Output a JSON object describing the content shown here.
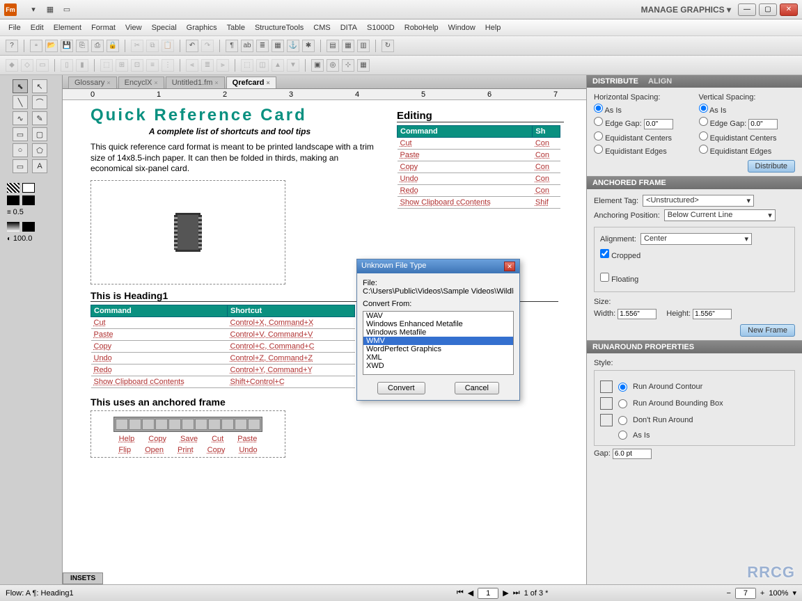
{
  "titlebar": {
    "manage": "MANAGE GRAPHICS ▾"
  },
  "menu": [
    "File",
    "Edit",
    "Element",
    "Format",
    "View",
    "Special",
    "Graphics",
    "Table",
    "StructureTools",
    "CMS",
    "DITA",
    "S1000D",
    "RoboHelp",
    "Window",
    "Help"
  ],
  "tabs": [
    {
      "label": "Glossary",
      "active": false
    },
    {
      "label": "EncyclX",
      "active": false
    },
    {
      "label": "Untitled1.fm",
      "active": false
    },
    {
      "label": "Qrefcard",
      "active": true
    }
  ],
  "ruler": [
    "0",
    "1",
    "2",
    "3",
    "4",
    "5",
    "6",
    "7"
  ],
  "doc": {
    "title": "Quick Reference Card",
    "subtitle": "A complete list of shortcuts and tool tips",
    "body": "This quick reference card format is meant to be printed landscape with a trim size of 14x8.5-inch paper. It can then be folded in thirds, making an economical six-panel card.",
    "heading1": "This is Heading1",
    "col_cmd": "Command",
    "col_sc": "Shortcut",
    "rows": [
      {
        "c": "Cut",
        "s": "Control+X, Command+X"
      },
      {
        "c": "Paste",
        "s": "Control+V, Command+V"
      },
      {
        "c": "Copy",
        "s": "Control+C, Command+C"
      },
      {
        "c": "Undo",
        "s": "Control+Z, Command+Z"
      },
      {
        "c": "Redo",
        "s": "Control+Y, Command+Y"
      },
      {
        "c": "Show Clipboard cContents",
        "s": "Shift+Control+C"
      }
    ],
    "heading2": "This uses an anchored frame",
    "icon_labels_top": [
      "Help",
      "Copy",
      "Save",
      "Cut",
      "Paste"
    ],
    "icon_labels_bot": [
      "Flip",
      "Open",
      "Print",
      "Copy",
      "Undo"
    ],
    "editing_title": "Editing",
    "edit_col_cmd": "Command",
    "edit_col_sc": "Sh",
    "edit_rows": [
      {
        "c": "Cut",
        "s": "Con"
      },
      {
        "c": "Paste",
        "s": "Con"
      },
      {
        "c": "Copy",
        "s": "Con"
      },
      {
        "c": "Undo",
        "s": "Con"
      },
      {
        "c": "Redo",
        "s": "Con"
      },
      {
        "c": "Show Clipboard cContents",
        "s": "Shif"
      }
    ]
  },
  "dialog": {
    "title": "Unknown File Type",
    "file_lbl": "File:",
    "file_path": "C:\\Users\\Public\\Videos\\Sample Videos\\Wildli",
    "convert_lbl": "Convert From:",
    "options": [
      "WAV",
      "Windows Enhanced Metafile",
      "Windows Metafile",
      "WMV",
      "WordPerfect Graphics",
      "XML",
      "XWD"
    ],
    "selected": "WMV",
    "convert_btn": "Convert",
    "cancel_btn": "Cancel"
  },
  "distribute": {
    "tab1": "DISTRIBUTE",
    "tab2": "ALIGN",
    "hspacing": "Horizontal Spacing:",
    "vspacing": "Vertical Spacing:",
    "asis": "As Is",
    "edgegap": "Edge Gap:",
    "eq_centers": "Equidistant Centers",
    "eq_edges": "Equidistant Edges",
    "gap_val": "0.0\"",
    "btn": "Distribute"
  },
  "anchored": {
    "hdr": "ANCHORED FRAME",
    "tag_lbl": "Element Tag:",
    "tag_val": "<Unstructured>",
    "pos_lbl": "Anchoring Position:",
    "pos_val": "Below Current Line",
    "align_lbl": "Alignment:",
    "align_val": "Center",
    "cropped": "Cropped",
    "floating": "Floating",
    "size_lbl": "Size:",
    "width_lbl": "Width:",
    "height_lbl": "Height:",
    "width_val": "1.556\"",
    "height_val": "1.556\"",
    "btn": "New Frame"
  },
  "runaround": {
    "hdr": "RUNAROUND PROPERTIES",
    "style_lbl": "Style:",
    "opt1": "Run Around Contour",
    "opt2": "Run Around Bounding Box",
    "opt3": "Don't Run Around",
    "opt4": "As Is",
    "gap_lbl": "Gap:",
    "gap_val": "6.0 pt"
  },
  "status": {
    "flow": "Flow: A  ¶: Heading1",
    "page": "1 of 3 *",
    "page_num": "1",
    "zoom": "7",
    "percent": "100%"
  },
  "stroke": {
    "weight": "0.5",
    "opacity": "100.0"
  },
  "insets": "INSETS",
  "watermark": "RRCG"
}
